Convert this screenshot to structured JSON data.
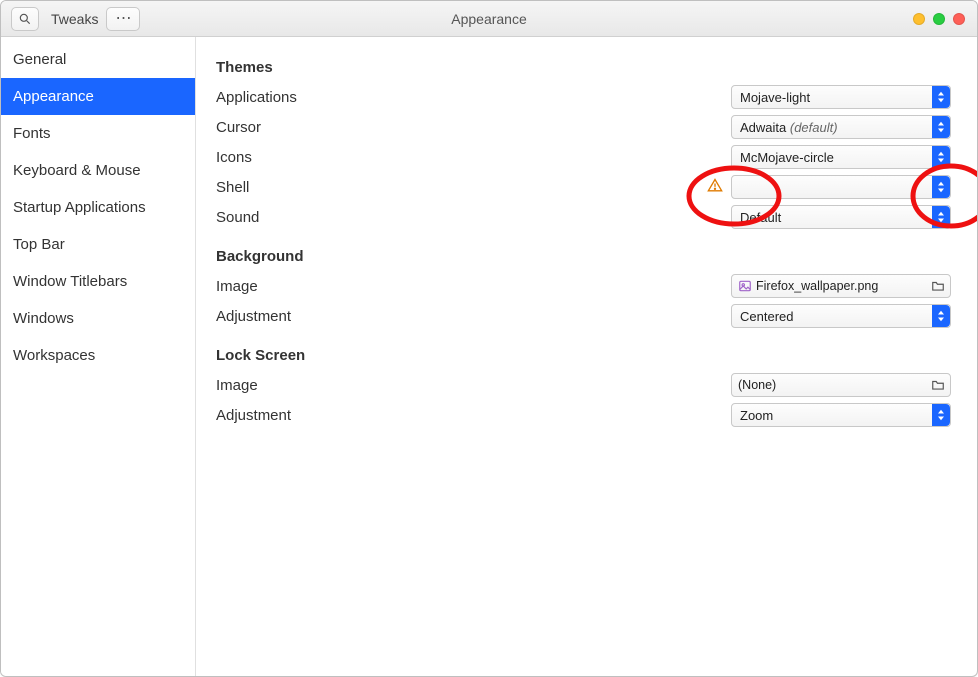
{
  "titlebar": {
    "app_name": "Tweaks",
    "window_title": "Appearance"
  },
  "sidebar": {
    "items": [
      {
        "label": "General",
        "selected": false
      },
      {
        "label": "Appearance",
        "selected": true
      },
      {
        "label": "Fonts",
        "selected": false
      },
      {
        "label": "Keyboard & Mouse",
        "selected": false
      },
      {
        "label": "Startup Applications",
        "selected": false
      },
      {
        "label": "Top Bar",
        "selected": false
      },
      {
        "label": "Window Titlebars",
        "selected": false
      },
      {
        "label": "Windows",
        "selected": false
      },
      {
        "label": "Workspaces",
        "selected": false
      }
    ]
  },
  "sections": {
    "themes": {
      "title": "Themes",
      "applications": {
        "label": "Applications",
        "value": "Mojave-light"
      },
      "cursor": {
        "label": "Cursor",
        "value": "Adwaita",
        "default_suffix": "(default)"
      },
      "icons": {
        "label": "Icons",
        "value": "McMojave-circle"
      },
      "shell": {
        "label": "Shell",
        "value": ""
      },
      "sound": {
        "label": "Sound",
        "value": "Default"
      }
    },
    "background": {
      "title": "Background",
      "image": {
        "label": "Image",
        "value": "Firefox_wallpaper.png"
      },
      "adjustment": {
        "label": "Adjustment",
        "value": "Centered"
      }
    },
    "lockscreen": {
      "title": "Lock Screen",
      "image": {
        "label": "Image",
        "value": "(None)"
      },
      "adjustment": {
        "label": "Adjustment",
        "value": "Zoom"
      }
    }
  }
}
